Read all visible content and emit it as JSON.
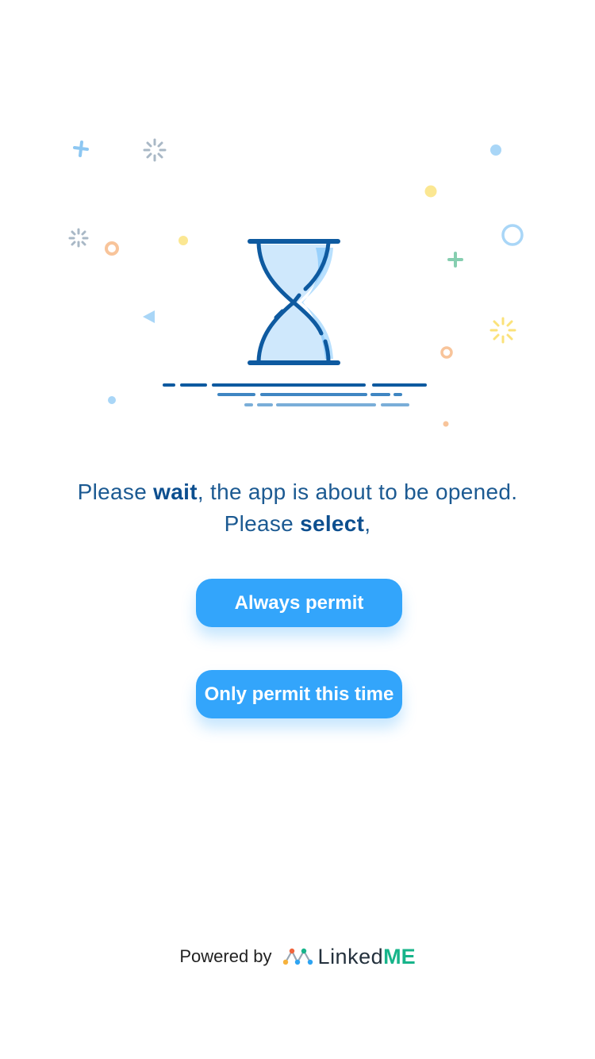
{
  "message": {
    "line1_before": "Please ",
    "line1_bold": "wait",
    "line1_after": ", the app is about to be opened.",
    "line2_before": "Please ",
    "line2_bold": "select",
    "line2_after": ","
  },
  "buttons": {
    "always_label": "Always permit",
    "once_label": "Only permit this time"
  },
  "footer": {
    "powered_label": "Powered by",
    "brand_part1": "Linked",
    "brand_part2": "ME"
  },
  "colors": {
    "accent": "#33a5fb",
    "text": "#1c5a92",
    "brand_green": "#17b48a"
  },
  "icons": {
    "illustration": "hourglass-icon",
    "logo": "linkedme-logo-icon"
  }
}
